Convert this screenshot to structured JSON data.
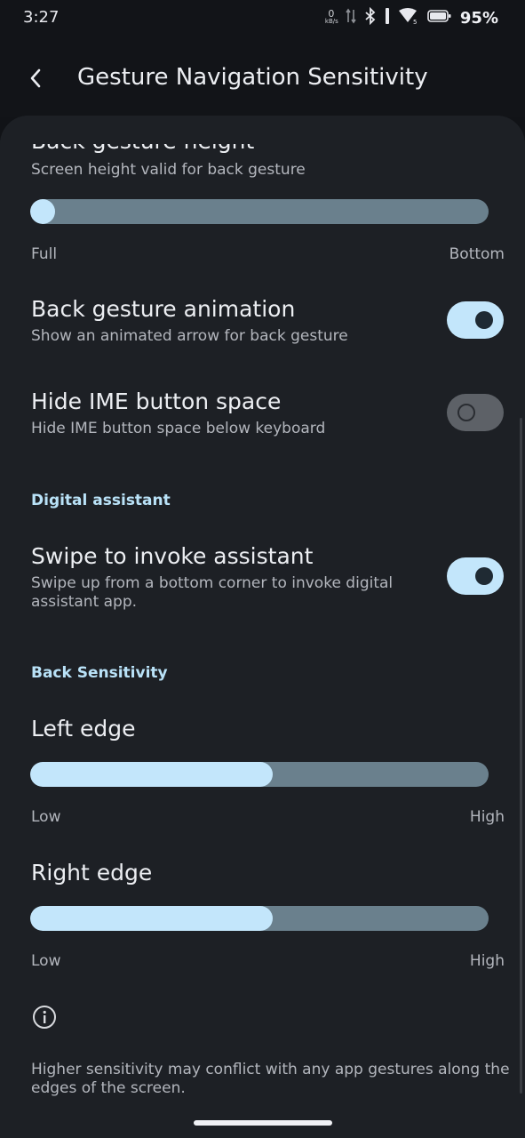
{
  "status_bar": {
    "time": "3:27",
    "net_speed_value": "0",
    "net_speed_unit": "kB/s",
    "battery_percent": "95%"
  },
  "app_bar": {
    "title": "Gesture Navigation Sensitivity"
  },
  "settings": {
    "back_gesture_height": {
      "title": "Back gesture height",
      "summary": "Screen height valid for back gesture",
      "min_label": "Full",
      "max_label": "Bottom",
      "value_fraction": 0.0
    },
    "back_gesture_animation": {
      "title": "Back gesture animation",
      "summary": "Show an animated arrow for back gesture",
      "enabled": true
    },
    "hide_ime_button_space": {
      "title": "Hide IME button space",
      "summary": "Hide IME button space below keyboard",
      "enabled": false
    },
    "digital_assistant_header": "Digital assistant",
    "swipe_to_invoke_assistant": {
      "title": "Swipe to invoke assistant",
      "summary": "Swipe up from a bottom corner to invoke digital assistant app.",
      "enabled": true
    },
    "back_sensitivity_header": "Back Sensitivity",
    "left_edge": {
      "title": "Left edge",
      "min_label": "Low",
      "max_label": "High",
      "value_fraction": 0.53
    },
    "right_edge": {
      "title": "Right edge",
      "min_label": "Low",
      "max_label": "High",
      "value_fraction": 0.53
    },
    "footer_note": "Higher sensitivity may conflict with any app gestures along the edges of the screen."
  },
  "colors": {
    "accent": "#c3e6fb",
    "track": "#6a808d",
    "background": "#1d2025",
    "section_header": "#b9e2f8"
  }
}
